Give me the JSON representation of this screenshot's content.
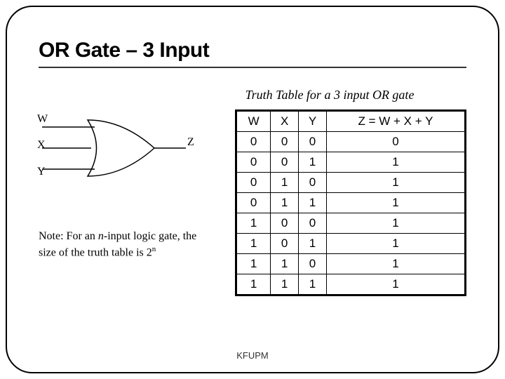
{
  "title": "OR Gate – 3 Input",
  "caption": "Truth Table for a 3 input OR gate",
  "gate": {
    "inputs": [
      "W",
      "X",
      "Y"
    ],
    "output": "Z"
  },
  "note": {
    "prefix": "Note: For an ",
    "nvar": "n",
    "mid": "-input logic gate, the size of the truth table is 2",
    "exp": "n"
  },
  "truth_table": {
    "headers": [
      "W",
      "X",
      "Y",
      "Z = W + X + Y"
    ],
    "rows": [
      [
        "0",
        "0",
        "0",
        "0"
      ],
      [
        "0",
        "0",
        "1",
        "1"
      ],
      [
        "0",
        "1",
        "0",
        "1"
      ],
      [
        "0",
        "1",
        "1",
        "1"
      ],
      [
        "1",
        "0",
        "0",
        "1"
      ],
      [
        "1",
        "0",
        "1",
        "1"
      ],
      [
        "1",
        "1",
        "0",
        "1"
      ],
      [
        "1",
        "1",
        "1",
        "1"
      ]
    ]
  },
  "footer": "KFUPM",
  "chart_data": {
    "type": "table",
    "title": "Truth Table for a 3 input OR gate",
    "columns": [
      "W",
      "X",
      "Y",
      "Z = W + X + Y"
    ],
    "rows": [
      [
        0,
        0,
        0,
        0
      ],
      [
        0,
        0,
        1,
        1
      ],
      [
        0,
        1,
        0,
        1
      ],
      [
        0,
        1,
        1,
        1
      ],
      [
        1,
        0,
        0,
        1
      ],
      [
        1,
        0,
        1,
        1
      ],
      [
        1,
        1,
        0,
        1
      ],
      [
        1,
        1,
        1,
        1
      ]
    ]
  }
}
